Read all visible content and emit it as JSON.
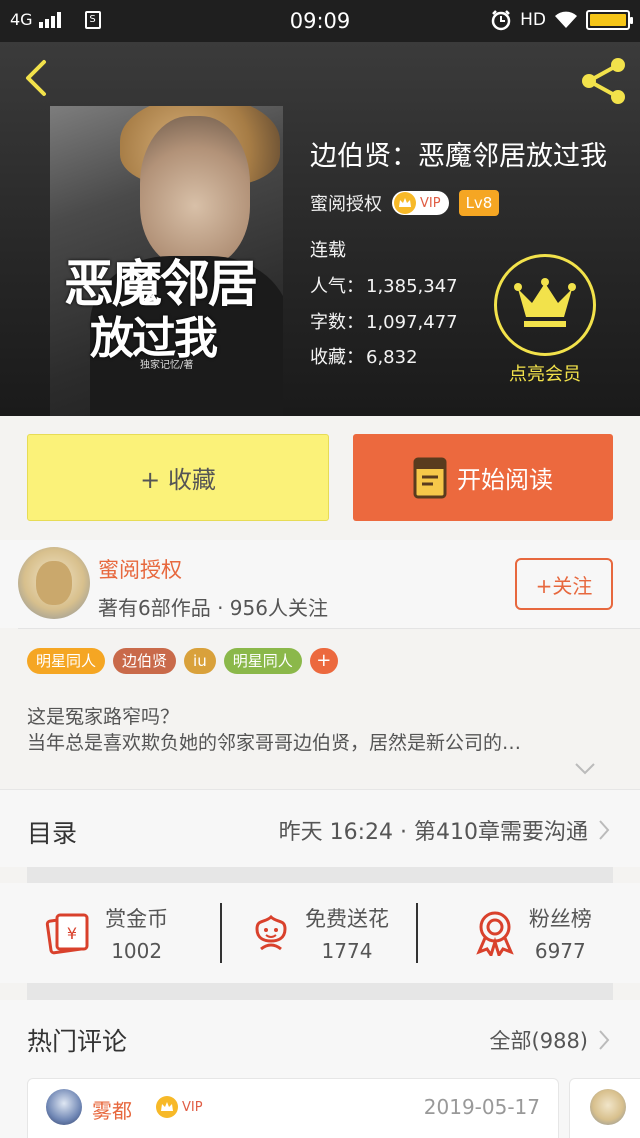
{
  "status_bar": {
    "network": "4G",
    "sim_label": "S",
    "time": "09:09",
    "hd": "HD"
  },
  "header": {
    "back": "back-arrow",
    "share": "share-icon"
  },
  "book": {
    "cover_title_line1": "恶魔邻居",
    "cover_title_line2": "放过我",
    "cover_author": "独家记忆/著",
    "title": "边伯贤：恶魔邻居放过我",
    "author": "蜜阅授权",
    "vip": "VIP",
    "level": "Lv8",
    "status": "连载",
    "popularity_label": "人气：",
    "popularity": "1,385,347",
    "words_label": "字数：",
    "words": "1,097,477",
    "favorites_label": "收藏：",
    "favorites": "6,832",
    "member_label": "点亮会员"
  },
  "actions": {
    "collect": "+ 收藏",
    "read": "开始阅读"
  },
  "author_info": {
    "name": "蜜阅授权",
    "meta": "著有6部作品 · 956人关注",
    "follow": "+关注"
  },
  "tags": [
    {
      "label": "明星同人",
      "color": "#f5a623"
    },
    {
      "label": "边伯贤",
      "color": "#c96a4a"
    },
    {
      "label": "iu",
      "color": "#d9a13b"
    },
    {
      "label": "明星同人",
      "color": "#8bb84a"
    },
    {
      "label": "+",
      "color": "#ec693e"
    }
  ],
  "description": {
    "line1": "这是冤家路窄吗？",
    "line2": "当年总是喜欢欺负她的邻家哥哥边伯贤，居然是新公司的…"
  },
  "toc": {
    "title": "目录",
    "latest": "昨天 16:24 · 第410章需要沟通"
  },
  "stats": [
    {
      "label": "赏金币",
      "value": "1002"
    },
    {
      "label": "免费送花",
      "value": "1774"
    },
    {
      "label": "粉丝榜",
      "value": "6977"
    }
  ],
  "comments": {
    "title": "热门评论",
    "all": "全部(988)",
    "first": {
      "user": "雾都",
      "vip": "VIP",
      "date": "2019-05-17"
    }
  },
  "colors": {
    "accent": "#ec693e",
    "collect_bg": "#fbf279",
    "member": "#f2e24b"
  }
}
